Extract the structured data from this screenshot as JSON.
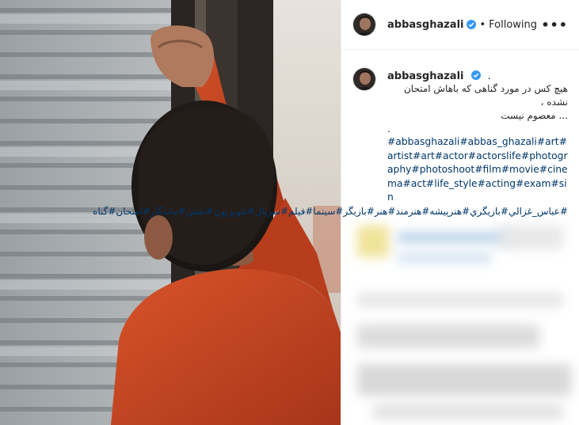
{
  "post": {
    "username": "abbasghazali",
    "follow_status": "Following",
    "more_label": "•••",
    "separator": "•"
  },
  "caption": {
    "username": "abbasghazali",
    "dot": ".",
    "line1": "هیچ کس در مورد گناهی که باهاش امتحان نشده ،",
    "line2": "... معصوم نیست",
    "line3": ".",
    "hashtags_en": "#abbasghazali#abbas_ghazali#art#artist#art#actor#actorslife#photography#photoshoot#film#movie#cinema#act#life_style#acting#exam#sin",
    "hashtags_fa": "#عباس_غزالي#بازيگري#هنرپيشه#هنرمند#هنر#بازيگر#سينما#فيلم#سريال#تلويزيون#نقش#ماندگار#امتحان#گناه"
  },
  "colors": {
    "link": "#00376b",
    "text": "#262626",
    "verified": "#3897f0",
    "shirt": "#c8451c"
  },
  "icons": [
    "verified-badge-icon",
    "more-options-icon"
  ]
}
